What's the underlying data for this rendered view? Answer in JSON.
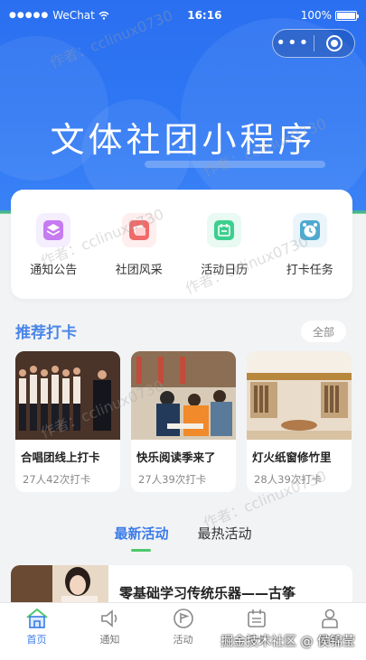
{
  "status_bar": {
    "signal": "●●●●●",
    "carrier": "WeChat",
    "time": "16:16",
    "battery": "100%"
  },
  "capsule": {
    "more_icon": "more-dots-icon",
    "close_icon": "target-close-icon"
  },
  "banner": {
    "title": "文体社团小程序"
  },
  "quick_menu": [
    {
      "label": "通知公告",
      "icon": "layers-icon",
      "color": "#c67bf0"
    },
    {
      "label": "社团风采",
      "icon": "cards-icon",
      "color": "#f06a6a"
    },
    {
      "label": "活动日历",
      "icon": "calendar-icon",
      "color": "#3ccf8e"
    },
    {
      "label": "打卡任务",
      "icon": "alarm-clock-icon",
      "color": "#4fa9cf"
    }
  ],
  "recommend": {
    "title": "推荐打卡",
    "all_label": "全部",
    "cards": [
      {
        "title": "合唱团线上打卡",
        "meta": "27人42次打卡"
      },
      {
        "title": "快乐阅读季来了",
        "meta": "27人39次打卡"
      },
      {
        "title": "灯火纸窗修竹里",
        "meta": "28人39次打卡"
      }
    ]
  },
  "activity_tabs": [
    {
      "label": "最新活动",
      "active": true
    },
    {
      "label": "最热活动",
      "active": false
    }
  ],
  "activity": {
    "title": "零基础学习传统乐器——古筝"
  },
  "tabbar": [
    {
      "label": "首页",
      "icon": "home-icon",
      "active": true
    },
    {
      "label": "通知",
      "icon": "speaker-icon",
      "active": false
    },
    {
      "label": "活动",
      "icon": "flag-circle-icon",
      "active": false
    },
    {
      "label": "打卡",
      "icon": "calendar-icon",
      "active": false
    },
    {
      "label": "我的",
      "icon": "user-icon",
      "active": false
    }
  ],
  "watermark": {
    "text": "作者：cclinux0730",
    "footer": "掘金技术社区 @ 侯锦莹"
  },
  "colors": {
    "primary": "#2f78f4",
    "accent_green": "#4cc96b",
    "text_blue": "#3a7be8"
  }
}
